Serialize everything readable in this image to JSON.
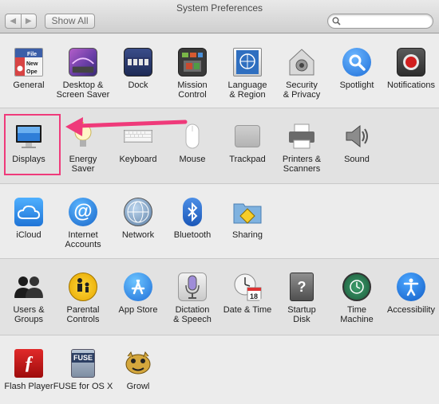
{
  "window": {
    "title": "System Preferences"
  },
  "toolbar": {
    "back_glyph": "◀",
    "forward_glyph": "▶",
    "show_all_label": "Show All",
    "search_value": "",
    "search_placeholder": ""
  },
  "sections": [
    {
      "items": [
        {
          "label": "General",
          "icon": "general-icon"
        },
        {
          "label": "Desktop &\nScreen Saver",
          "icon": "desktop-screen-saver-icon"
        },
        {
          "label": "Dock",
          "icon": "dock-icon"
        },
        {
          "label": "Mission\nControl",
          "icon": "mission-control-icon"
        },
        {
          "label": "Language\n& Region",
          "icon": "language-region-icon"
        },
        {
          "label": "Security\n& Privacy",
          "icon": "security-privacy-icon"
        },
        {
          "label": "Spotlight",
          "icon": "spotlight-icon"
        },
        {
          "label": "Notifications",
          "icon": "notifications-icon"
        }
      ]
    },
    {
      "items": [
        {
          "label": "Displays",
          "icon": "displays-icon"
        },
        {
          "label": "Energy\nSaver",
          "icon": "energy-saver-icon"
        },
        {
          "label": "Keyboard",
          "icon": "keyboard-icon"
        },
        {
          "label": "Mouse",
          "icon": "mouse-icon"
        },
        {
          "label": "Trackpad",
          "icon": "trackpad-icon"
        },
        {
          "label": "Printers &\nScanners",
          "icon": "printers-scanners-icon"
        },
        {
          "label": "Sound",
          "icon": "sound-icon"
        }
      ]
    },
    {
      "items": [
        {
          "label": "iCloud",
          "icon": "icloud-icon"
        },
        {
          "label": "Internet\nAccounts",
          "icon": "internet-accounts-icon"
        },
        {
          "label": "Network",
          "icon": "network-icon"
        },
        {
          "label": "Bluetooth",
          "icon": "bluetooth-icon"
        },
        {
          "label": "Sharing",
          "icon": "sharing-icon"
        }
      ]
    },
    {
      "items": [
        {
          "label": "Users &\nGroups",
          "icon": "users-groups-icon"
        },
        {
          "label": "Parental\nControls",
          "icon": "parental-controls-icon"
        },
        {
          "label": "App Store",
          "icon": "app-store-icon"
        },
        {
          "label": "Dictation\n& Speech",
          "icon": "dictation-speech-icon"
        },
        {
          "label": "Date & Time",
          "icon": "date-time-icon"
        },
        {
          "label": "Startup\nDisk",
          "icon": "startup-disk-icon"
        },
        {
          "label": "Time\nMachine",
          "icon": "time-machine-icon"
        },
        {
          "label": "Accessibility",
          "icon": "accessibility-icon"
        }
      ]
    },
    {
      "items": [
        {
          "label": "Flash Player",
          "icon": "flash-player-icon"
        },
        {
          "label": "FUSE for OS X",
          "icon": "fuse-icon"
        },
        {
          "label": "Growl",
          "icon": "growl-icon"
        }
      ]
    }
  ],
  "icon_text": {
    "general_file": "File",
    "general_new": "New",
    "general_open": "Ope",
    "date_day": "18",
    "fuse": "FUSE"
  },
  "annotation": {
    "highlight_color": "#ef3a7a",
    "arrow_color": "#ef3a7a"
  }
}
